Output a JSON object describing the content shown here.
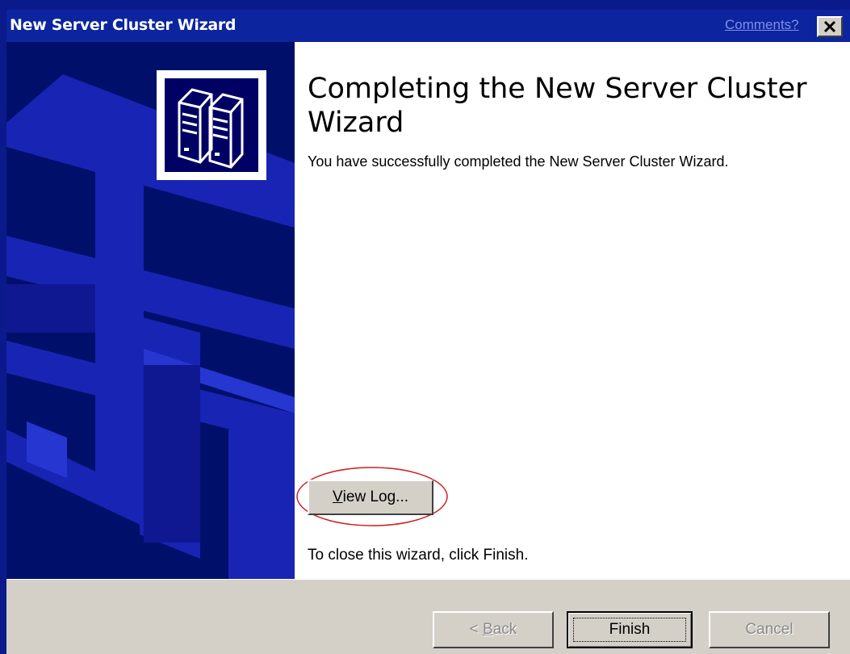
{
  "window": {
    "title": "New Server Cluster Wizard",
    "comments_link": "Comments?"
  },
  "page": {
    "heading": "Completing the New Server Cluster Wizard",
    "description": "You have successfully completed the New Server Cluster Wizard.",
    "view_log": {
      "mnemonic": "V",
      "rest": "iew Log..."
    },
    "close_note": "To close this wizard, click Finish."
  },
  "buttons": {
    "back": {
      "prefix": "< ",
      "mnemonic": "B",
      "rest": "ack",
      "enabled": false
    },
    "finish": {
      "label": "Finish",
      "enabled": true
    },
    "cancel": {
      "label": "Cancel",
      "enabled": false
    }
  },
  "colors": {
    "desktop": "#0a1a8a",
    "titlebar": "#0c249e",
    "banner": "#00106a",
    "face": "#d4d0c8",
    "highlight_ellipse": "#d02020"
  },
  "icons": [
    "close-icon",
    "server-cluster-icon"
  ]
}
